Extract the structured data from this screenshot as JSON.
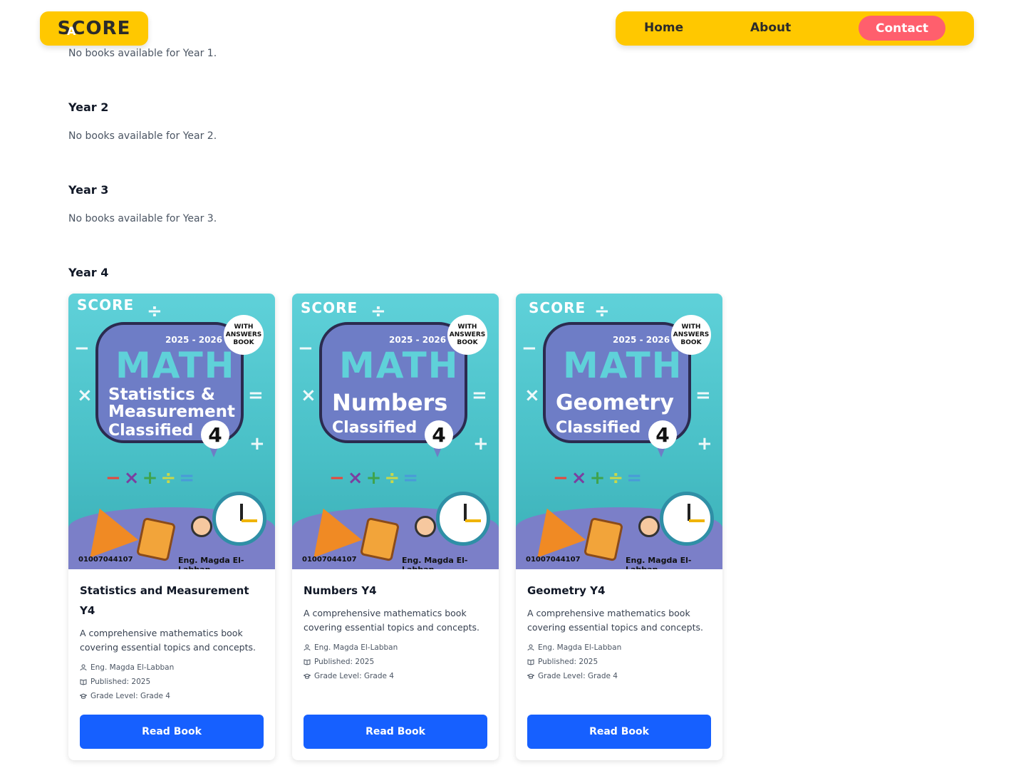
{
  "header": {
    "logo_text": "SCORE",
    "logo_sub": "A",
    "nav": {
      "home": "Home",
      "about": "About",
      "contact": "Contact"
    }
  },
  "sections": {
    "year1": {
      "empty": "No books available for Year 1."
    },
    "year2": {
      "title": "Year 2",
      "empty": "No books available for Year 2."
    },
    "year3": {
      "title": "Year 3",
      "empty": "No books available for Year 3."
    },
    "year4": {
      "title": "Year 4"
    }
  },
  "cover_common": {
    "logo": "SCORE",
    "years": "2025 - 2026",
    "math": "MATH",
    "classified": "Classified",
    "grade_number": "4",
    "badge": "WITH ANSWERS BOOK",
    "phone": "01007044107",
    "author": "Eng. Magda El-Labban"
  },
  "books": [
    {
      "cover_subject": "Statistics & Measurement",
      "title": "Statistics and Measurement Y4",
      "description": "A comprehensive mathematics book covering essential topics and concepts.",
      "author": "Eng. Magda El-Labban",
      "published": "Published: 2025",
      "grade": "Grade Level: Grade 4",
      "button": "Read Book"
    },
    {
      "cover_subject": "Numbers",
      "title": "Numbers Y4",
      "description": "A comprehensive mathematics book covering essential topics and concepts.",
      "author": "Eng. Magda El-Labban",
      "published": "Published: 2025",
      "grade": "Grade Level: Grade 4",
      "button": "Read Book"
    },
    {
      "cover_subject": "Geometry",
      "title": "Geometry Y4",
      "description": "A comprehensive mathematics book covering essential topics and concepts.",
      "author": "Eng. Magda El-Labban",
      "published": "Published: 2025",
      "grade": "Grade Level: Grade 4",
      "button": "Read Book"
    }
  ],
  "colors": {
    "header_yellow": "#ffc800",
    "contact_red": "#ff5f6d",
    "button_blue": "#1660ff",
    "cover_teal": "#5fd1d9",
    "cover_purple": "#6e7dc6"
  }
}
